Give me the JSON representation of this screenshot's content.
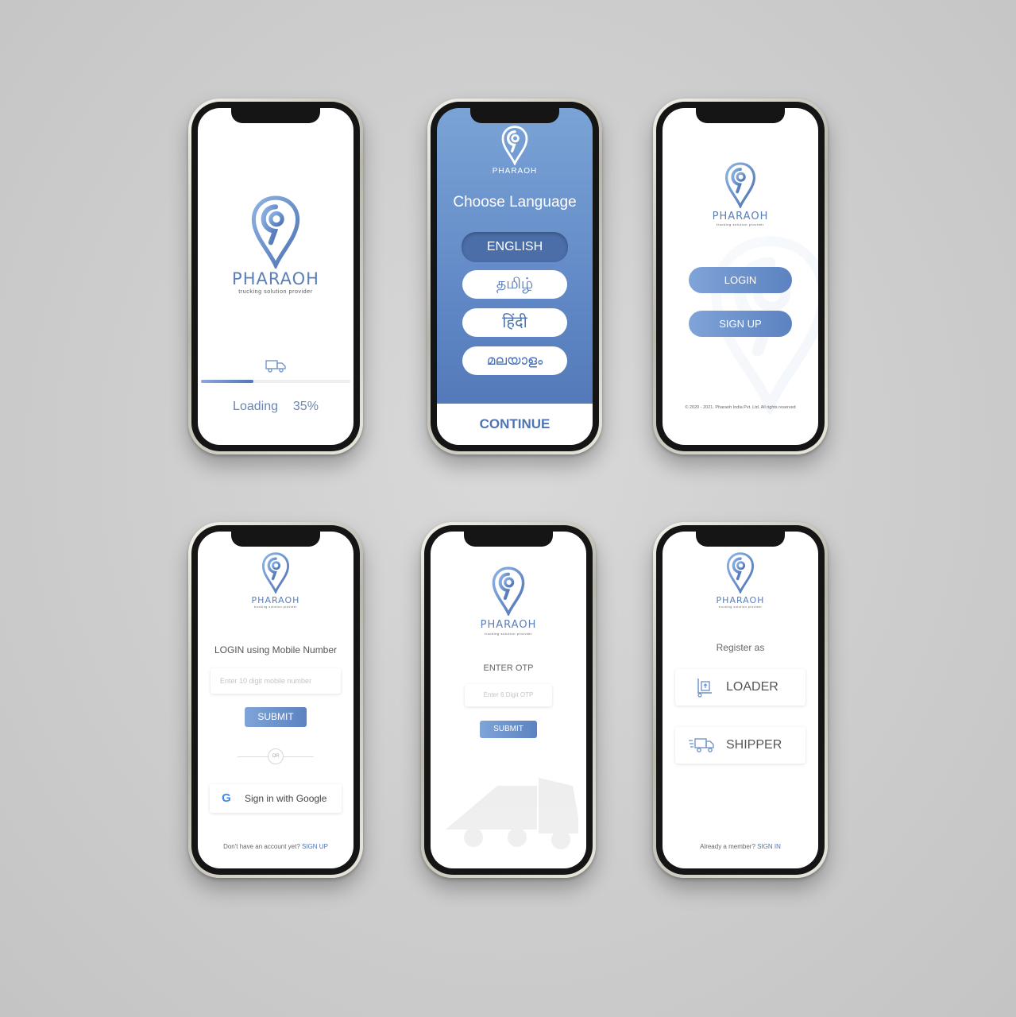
{
  "colors": {
    "accent": "#5c82c1",
    "accent_light": "#7fa4d8",
    "lang_bg_top": "#7aa3d6",
    "lang_bg_bottom": "#4f74b4"
  },
  "splash": {
    "brand": "PHARAOH",
    "tagline": "trucking solution provider",
    "loading_label": "Loading",
    "loading_percent": "35%",
    "progress": 0.35
  },
  "language": {
    "brand": "PHARAOH",
    "title": "Choose Language",
    "options": [
      "ENGLISH",
      "தமிழ்",
      "हिंदी",
      "മലയാളം"
    ],
    "selected": "ENGLISH",
    "continue_label": "CONTINUE"
  },
  "welcome": {
    "brand": "PHARAOH",
    "tagline": "trucking solution provider",
    "login_label": "LOGIN",
    "signup_label": "SIGN UP",
    "copyright": "© 2020 - 2021. Pharaoh India Pvt. Ltd. All rights reserved"
  },
  "login": {
    "brand": "PHARAOH",
    "tagline": "trucking solution provider",
    "heading": "LOGIN using Mobile Number",
    "mobile_placeholder": "Enter 10 digit mobile number",
    "submit_label": "SUBMIT",
    "divider_label": "OR",
    "google_label": "Sign in with Google",
    "footer_text": "Don't have an account yet?",
    "footer_link": "SIGN UP"
  },
  "otp": {
    "brand": "PHARAOH",
    "tagline": "trucking solution provider",
    "heading": "ENTER OTP",
    "otp_placeholder": "Enter 6 Digit OTP",
    "submit_label": "SUBMIT"
  },
  "register": {
    "brand": "PHARAOH",
    "tagline": "trucking solution provider",
    "heading": "Register as",
    "loader_label": "LOADER",
    "shipper_label": "SHIPPER",
    "footer_text": "Already a member?",
    "footer_link": "SIGN IN"
  }
}
